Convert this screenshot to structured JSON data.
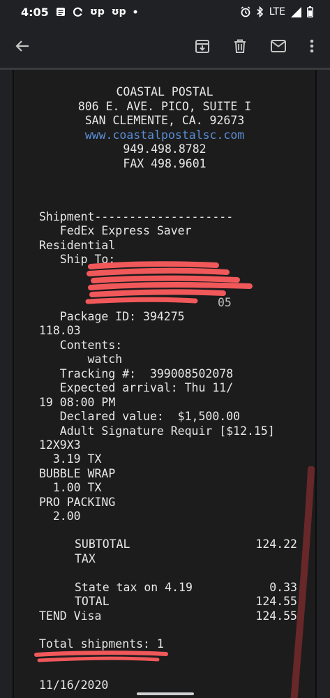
{
  "status_bar": {
    "time": "4:05",
    "notif_icons": [
      "message-icon",
      "sync-icon",
      "upwork-icon",
      "upwork-icon",
      "dot-icon"
    ],
    "up1": "ʊp",
    "up2": "ʊp",
    "network": "LTE"
  },
  "toolbar": {
    "icons": [
      "back-arrow-icon",
      "archive-icon",
      "delete-icon",
      "mail-icon",
      "more-icon"
    ]
  },
  "receipt": {
    "header": [
      "COASTAL POSTAL",
      "806 E. AVE. PICO, SUITE I",
      "SAN CLEMENTE, CA. 92673"
    ],
    "url": "www.coastalpostalsc.com",
    "phone": "949.498.8782",
    "fax": "FAX 498.9601",
    "lines": [
      "Shipment--------------------",
      "   FedEx Express Saver",
      "Residential",
      "   Ship To:",
      "   Package ID: 394275",
      "118.03",
      "   Contents:",
      "       watch",
      "   Tracking #:  399008502078",
      "   Expected arrival: Thu 11/",
      "19 08:00 PM",
      "   Declared value:  $1,500.00",
      "   Adult Signature Requir [$12.15]",
      "12X9X3",
      "  3.19 TX",
      "BUBBLE WRAP",
      "  1.00 TX",
      "PRO PACKING",
      "  2.00"
    ],
    "partial_address": "05",
    "totals": {
      "subtotal_label": "SUBTOTAL",
      "subtotal": "124.22",
      "tax_label": "TAX",
      "state_tax_label": "State tax on 4.19",
      "state_tax": "0.33",
      "total_label": "TOTAL",
      "total": "124.55",
      "tend_label": "TEND Visa",
      "tend": "124.55"
    },
    "shipments": "Total shipments: 1",
    "date_partial": "11/16/2020"
  },
  "colors": {
    "background": "#202124",
    "receipt": "#1c1c1d",
    "link": "#5b8fd6",
    "redaction": "#f0585a"
  }
}
